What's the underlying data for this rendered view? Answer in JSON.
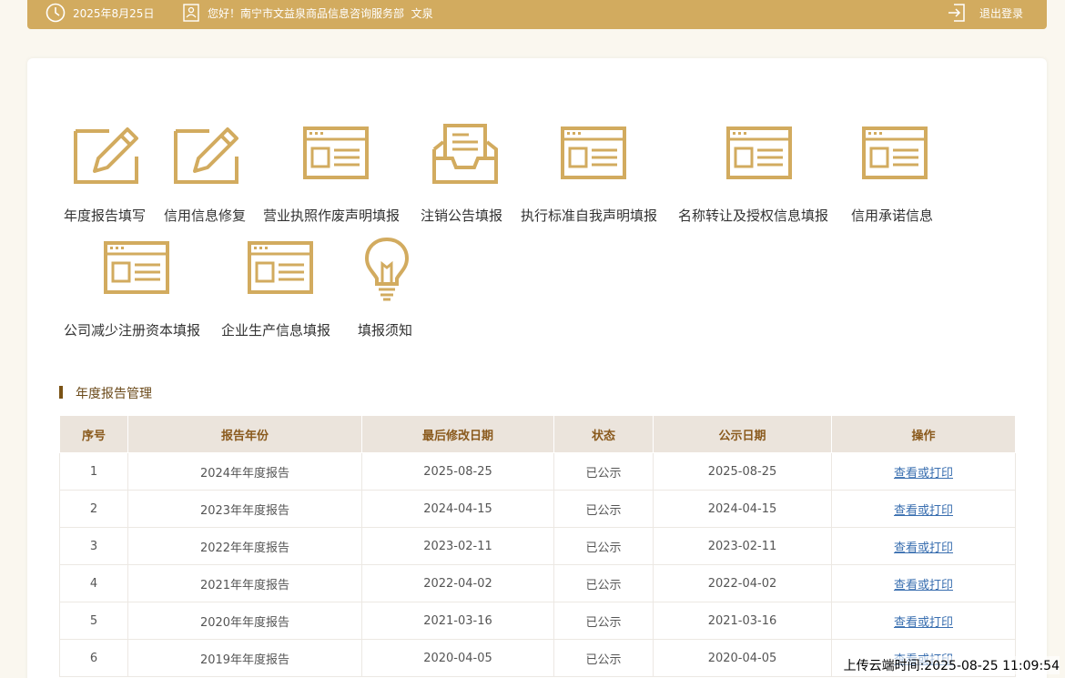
{
  "topbar": {
    "date": "2025年8月25日",
    "greeting": "您好！南宁市文益泉商品信息咨询服务部  文泉",
    "logout": "退出登录"
  },
  "tiles": [
    {
      "label": "年度报告填写",
      "icon": "edit-icon"
    },
    {
      "label": "信用信息修复",
      "icon": "edit-icon"
    },
    {
      "label": "营业执照作废声明填报",
      "icon": "form-icon"
    },
    {
      "label": "注销公告填报",
      "icon": "inbox-icon"
    },
    {
      "label": "执行标准自我声明填报",
      "icon": "form-icon"
    },
    {
      "label": "名称转让及授权信息填报",
      "icon": "form-icon"
    },
    {
      "label": "信用承诺信息",
      "icon": "form-icon"
    },
    {
      "label": "公司减少注册资本填报",
      "icon": "form-icon"
    },
    {
      "label": "企业生产信息填报",
      "icon": "form-icon"
    },
    {
      "label": "填报须知",
      "icon": "lightbulb-icon"
    }
  ],
  "section": {
    "title": "年度报告管理"
  },
  "table": {
    "headers": [
      "序号",
      "报告年份",
      "最后修改日期",
      "状态",
      "公示日期",
      "操作"
    ],
    "rows": [
      [
        "1",
        "2024年年度报告",
        "2025-08-25",
        "已公示",
        "2025-08-25",
        "查看或打印"
      ],
      [
        "2",
        "2023年年度报告",
        "2024-04-15",
        "已公示",
        "2024-04-15",
        "查看或打印"
      ],
      [
        "3",
        "2022年年度报告",
        "2023-02-11",
        "已公示",
        "2023-02-11",
        "查看或打印"
      ],
      [
        "4",
        "2021年年度报告",
        "2022-04-02",
        "已公示",
        "2022-04-02",
        "查看或打印"
      ],
      [
        "5",
        "2020年年度报告",
        "2021-03-16",
        "已公示",
        "2021-03-16",
        "查看或打印"
      ],
      [
        "6",
        "2019年年度报告",
        "2020-04-05",
        "已公示",
        "2020-04-05",
        "查看或打印"
      ]
    ]
  },
  "watermark": "上传云端时间:2025-08-25 11:09:54",
  "colors": {
    "accent": "#d2ab5f",
    "header_bg": "#ebe4dc",
    "link": "#3a6fb0"
  }
}
